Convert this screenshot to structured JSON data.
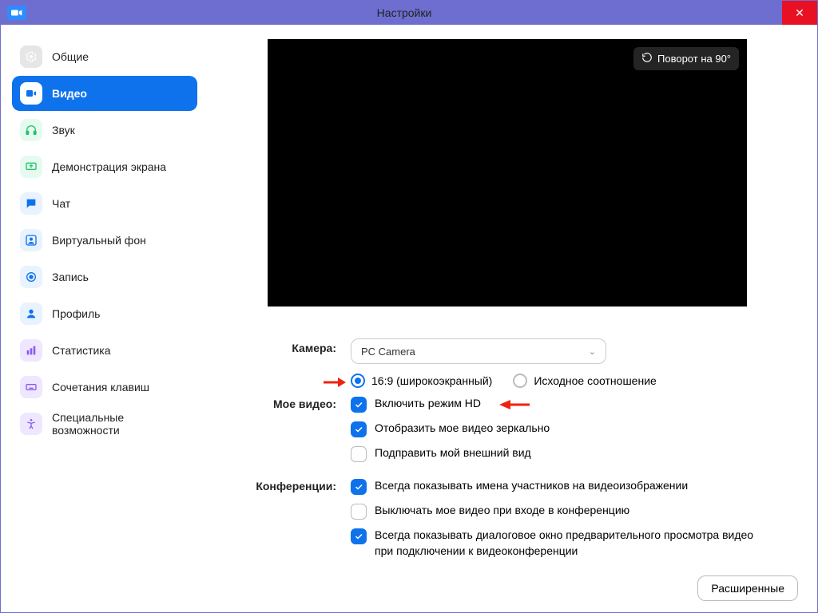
{
  "window": {
    "title": "Настройки",
    "close_label": "✕"
  },
  "sidebar": {
    "items": [
      {
        "key": "general",
        "label": "Общие",
        "icon": "gear",
        "bg": "#e6e6e6",
        "fg": "#ffffff"
      },
      {
        "key": "video",
        "label": "Видео",
        "icon": "video",
        "bg": "#ffffff",
        "fg": "#0e72ed",
        "active": true
      },
      {
        "key": "audio",
        "label": "Звук",
        "icon": "headphones",
        "bg": "#e6fbef",
        "fg": "#27c26c"
      },
      {
        "key": "share",
        "label": "Демонстрация экрана",
        "icon": "share",
        "bg": "#e6fbef",
        "fg": "#27c26c"
      },
      {
        "key": "chat",
        "label": "Чат",
        "icon": "chat",
        "bg": "#e8f3ff",
        "fg": "#0e72ed"
      },
      {
        "key": "vbg",
        "label": "Виртуальный фон",
        "icon": "person-bg",
        "bg": "#e8f3ff",
        "fg": "#0e72ed"
      },
      {
        "key": "record",
        "label": "Запись",
        "icon": "record",
        "bg": "#e8f3ff",
        "fg": "#0e72ed"
      },
      {
        "key": "profile",
        "label": "Профиль",
        "icon": "profile",
        "bg": "#e8f3ff",
        "fg": "#0e72ed"
      },
      {
        "key": "stats",
        "label": "Статистика",
        "icon": "stats",
        "bg": "#efe6ff",
        "fg": "#8a5cf0"
      },
      {
        "key": "shortcuts",
        "label": "Сочетания клавиш",
        "icon": "keyboard",
        "bg": "#efe6ff",
        "fg": "#8a5cf0"
      },
      {
        "key": "a11y",
        "label": "Специальные возможности",
        "icon": "a11y",
        "bg": "#efe6ff",
        "fg": "#8a5cf0"
      }
    ]
  },
  "video": {
    "rotate_label": "Поворот на 90°",
    "camera_label": "Камера:",
    "camera_value": "PC Camera",
    "aspect_16_9": "16:9 (широкоэкранный)",
    "aspect_original": "Исходное соотношение",
    "my_video_label": "Мое видео:",
    "hd_label": "Включить режим HD",
    "mirror_label": "Отобразить мое видео зеркально",
    "touchup_label": "Подправить мой внешний вид",
    "meetings_label": "Конференции:",
    "names_label": "Всегда показывать имена участников на видеоизображении",
    "mute_video_label": "Выключать мое видео при входе в конференцию",
    "preview_dialog_label": "Всегда показывать диалоговое окно предварительного просмотра видео при подключении к видеоконференции",
    "advanced_label": "Расширенные"
  },
  "state": {
    "aspect": "16_9",
    "hd": true,
    "mirror": true,
    "touchup": false,
    "names": true,
    "mute_video": false,
    "preview_dialog": true
  }
}
